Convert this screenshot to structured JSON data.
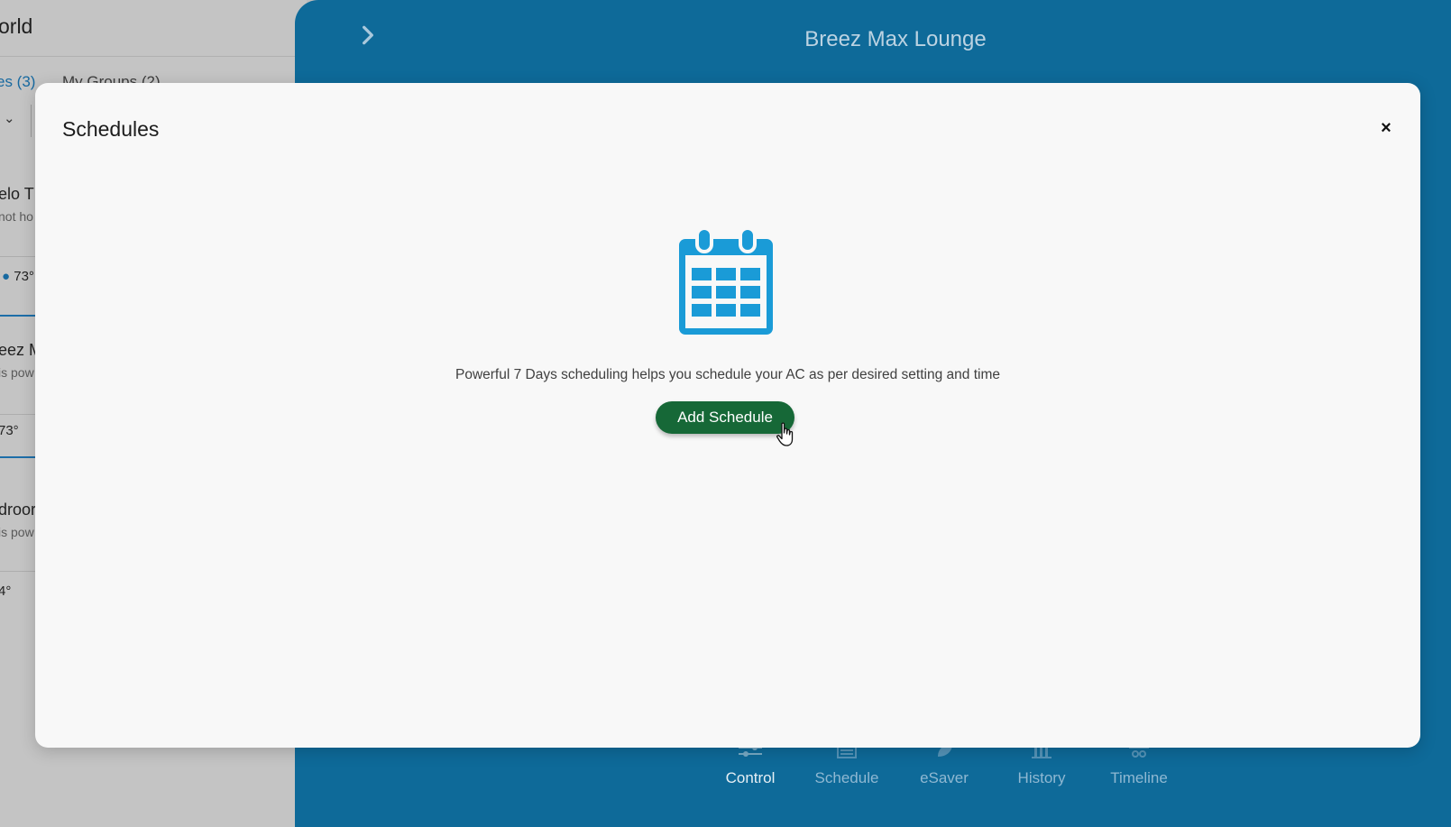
{
  "left_panel": {
    "title_fragment": "orld",
    "tabs": [
      {
        "label": "es (3)",
        "active": true
      },
      {
        "label": "My Groups (2)",
        "active": false
      }
    ],
    "devices": [
      {
        "name": "elo Th",
        "status": "not ho",
        "temp": "73°"
      },
      {
        "name": "eez M",
        "status": "is pow",
        "temp": "73°"
      },
      {
        "name": "droor",
        "status": "is pow",
        "temp": "4°"
      }
    ]
  },
  "device_pane": {
    "title": "Breez Max Lounge",
    "back_icon": "chevron-right-icon",
    "nav": [
      {
        "label": "Control",
        "icon": "sliders-icon",
        "active": true
      },
      {
        "label": "Schedule",
        "icon": "calendar-icon",
        "active": false
      },
      {
        "label": "eSaver",
        "icon": "leaf-icon",
        "active": false
      },
      {
        "label": "History",
        "icon": "bar-chart-icon",
        "active": false
      },
      {
        "label": "Timeline",
        "icon": "timeline-icon",
        "active": false
      }
    ]
  },
  "modal": {
    "title": "Schedules",
    "close_label": "×",
    "illustration_icon": "calendar-icon",
    "empty_message": "Powerful 7 Days scheduling helps you schedule your AC as per desired setting and time",
    "add_button_label": "Add Schedule"
  },
  "colors": {
    "accent_blue": "#1a9bd7",
    "device_pane_bg": "#0e6a99",
    "add_button_bg": "#166837",
    "modal_bg": "#f8f8f8"
  }
}
